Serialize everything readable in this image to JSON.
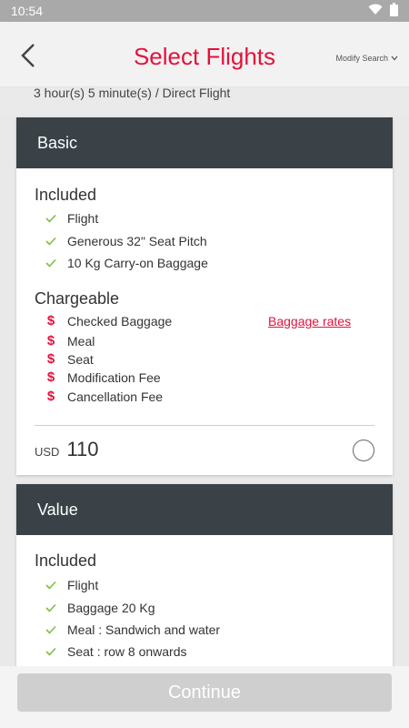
{
  "status": {
    "time": "10:54"
  },
  "header": {
    "title": "Select Flights",
    "modify_label": "Modify Search"
  },
  "subheader": {
    "duration": "3 hour(s) 5 minute(s) / Direct Flight"
  },
  "fares": [
    {
      "name": "Basic",
      "included_title": "Included",
      "included": [
        "Flight",
        "Generous 32\" Seat Pitch",
        "10 Kg Carry-on Baggage"
      ],
      "chargeable_title": "Chargeable",
      "chargeable": [
        "Checked Baggage",
        "Meal",
        "Seat",
        "Modification Fee",
        "Cancellation Fee"
      ],
      "baggage_link": "Baggage rates",
      "currency": "USD",
      "price": "110"
    },
    {
      "name": "Value",
      "included_title": "Included",
      "included": [
        "Flight",
        "Baggage 20 Kg",
        "Meal : Sandwich and water",
        "Seat : row 8 onwards"
      ]
    }
  ],
  "continue_label": "Continue",
  "colors": {
    "brand": "#e3123c",
    "card_header": "#3a4247",
    "check": "#7bc043"
  }
}
